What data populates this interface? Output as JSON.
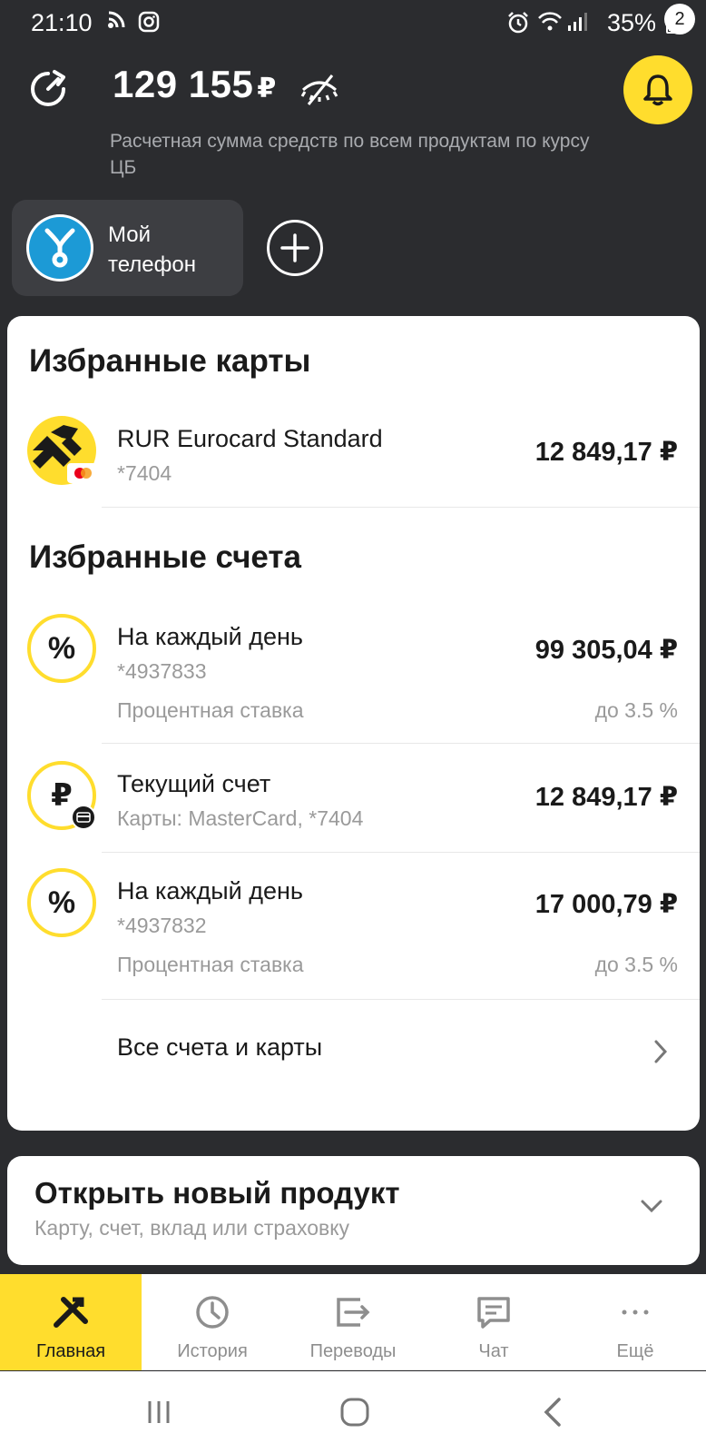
{
  "status_bar": {
    "time": "21:10",
    "battery": "35%"
  },
  "header": {
    "balance": "129 155",
    "currency": "₽",
    "subtitle": "Расчетная сумма средств по всем продуктам по курсу ЦБ",
    "notifications_count": "2"
  },
  "shortcuts": [
    {
      "label_line1": "Мой",
      "label_line2": "телефон"
    }
  ],
  "favorite_cards": {
    "title": "Избранные карты",
    "items": [
      {
        "name": "RUR Eurocard Standard",
        "number": "*7404",
        "amount": "12 849,17 ₽"
      }
    ]
  },
  "favorite_accounts": {
    "title": "Избранные счета",
    "items": [
      {
        "icon": "percent-icon",
        "name": "На каждый день",
        "number": "*4937833",
        "amount": "99 305,04 ₽",
        "rate_label": "Процентная ставка",
        "rate_value": "до 3.5 %"
      },
      {
        "icon": "ruble-icon",
        "name": "Текущий счет",
        "number": "Карты: MasterCard, *7404",
        "amount": "12 849,17 ₽"
      },
      {
        "icon": "percent-icon",
        "name": "На каждый день",
        "number": "*4937832",
        "amount": "17 000,79 ₽",
        "rate_label": "Процентная ставка",
        "rate_value": "до 3.5 %"
      }
    ],
    "all_link": "Все счета и карты"
  },
  "open_product": {
    "title": "Открыть новый продукт",
    "subtitle": "Карту, счет, вклад или страховку"
  },
  "bottom_nav": [
    {
      "label": "Главная",
      "icon": "home-icon",
      "active": true
    },
    {
      "label": "История",
      "icon": "clock-icon",
      "active": false
    },
    {
      "label": "Переводы",
      "icon": "transfer-icon",
      "active": false
    },
    {
      "label": "Чат",
      "icon": "chat-icon",
      "active": false
    },
    {
      "label": "Ещё",
      "icon": "more-icon",
      "active": false
    }
  ],
  "colors": {
    "background": "#2b2c2f",
    "accent": "#ffdd2d",
    "panel": "#ffffff"
  }
}
